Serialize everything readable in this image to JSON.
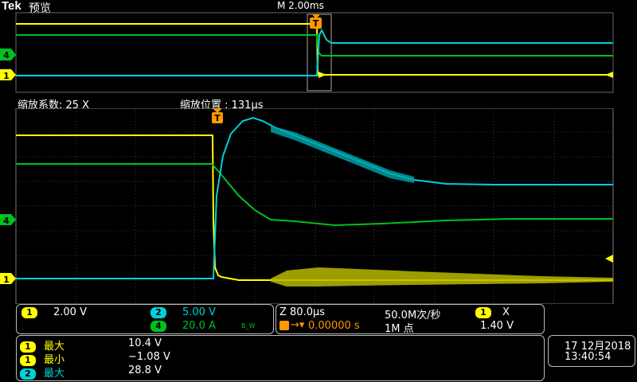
{
  "header": {
    "logo": "Tek",
    "mode": "预览",
    "timebase": "M 2.00ms"
  },
  "zoom": {
    "factor": "缩放系数: 25 X",
    "position": "缩放位置 :  131µs"
  },
  "channels_panel": {
    "ch1": {
      "badge": "1",
      "value": "2.00 V"
    },
    "ch2": {
      "badge": "2",
      "value": "5.00 V"
    },
    "ch4": {
      "badge": "4",
      "value": "20.0 A",
      "bw": "B_W"
    }
  },
  "timing_panel": {
    "zoom_scale": "Z 80.0µs",
    "trigger_pos": "0.00000 s",
    "sample_rate": "50.0M次/秒",
    "record": "1M 点",
    "trig_ch": "1",
    "trig_sym": "Х",
    "trig_level": "1.40 V"
  },
  "measurements": [
    {
      "ch": "1",
      "label": "最大",
      "value": "10.4 V",
      "color": "#ffff00"
    },
    {
      "ch": "1",
      "label": "最小",
      "value": "−1.08 V",
      "color": "#ffff00"
    },
    {
      "ch": "2",
      "label": "最大",
      "value": "28.8 V",
      "color": "#00d0d8"
    }
  ],
  "datetime": {
    "date": "17 12月2018",
    "time": "13:40:54"
  },
  "markers": {
    "ch4": "4",
    "ch1": "1",
    "trigger": "T"
  },
  "colors": {
    "ch1": "#ffff00",
    "ch2": "#00d0d8",
    "ch4": "#00c020",
    "grid": "#444444",
    "frame": "#8a8a8a"
  }
}
